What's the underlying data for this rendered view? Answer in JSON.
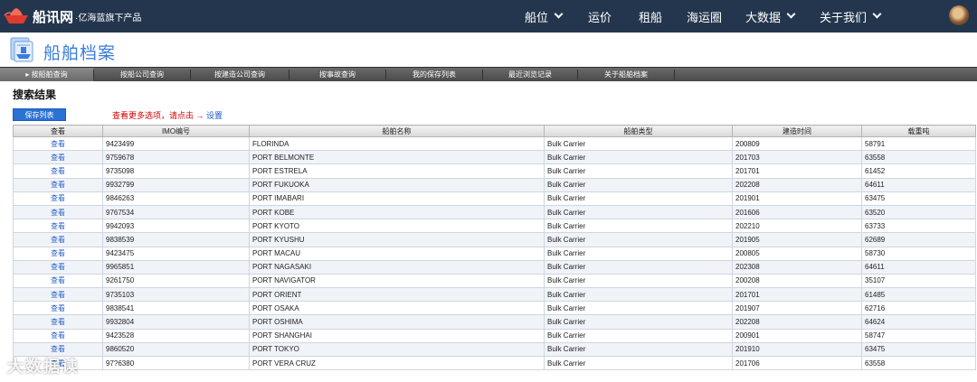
{
  "brand": {
    "name": "船讯网",
    "sub": "·亿海蓝旗下产品"
  },
  "nav": [
    {
      "label": "船位",
      "dropdown": true
    },
    {
      "label": "运价",
      "dropdown": false
    },
    {
      "label": "租船",
      "dropdown": false
    },
    {
      "label": "海运圈",
      "dropdown": false
    },
    {
      "label": "大数据",
      "dropdown": true
    },
    {
      "label": "关于我们",
      "dropdown": true
    }
  ],
  "header": {
    "title": "船舶档案"
  },
  "tabs": [
    {
      "label": "按船舶查询",
      "active": true
    },
    {
      "label": "按船公司查询",
      "active": false
    },
    {
      "label": "按建造公司查询",
      "active": false
    },
    {
      "label": "按事故查询",
      "active": false
    },
    {
      "label": "我的保存列表",
      "active": false
    },
    {
      "label": "最近浏览记录",
      "active": false
    },
    {
      "label": "关于船舶档案",
      "active": false
    }
  ],
  "results": {
    "title": "搜索结果",
    "save_label": "保存列表",
    "hint_text": "查看更多选项，请点击 →",
    "hint_link": "设置",
    "columns": [
      "查看",
      "IMO编号",
      "船舶名称",
      "船舶类型",
      "建造时间",
      "载重吨"
    ],
    "rows": [
      {
        "view": "查看",
        "imo": "9423499",
        "name": "FLORINDA",
        "type": "Bulk Carrier",
        "built": "200809",
        "dwt": "58791"
      },
      {
        "view": "查看",
        "imo": "9759678",
        "name": "PORT BELMONTE",
        "type": "Bulk Carrier",
        "built": "201703",
        "dwt": "63558"
      },
      {
        "view": "查看",
        "imo": "9735098",
        "name": "PORT ESTRELA",
        "type": "Bulk Carrier",
        "built": "201701",
        "dwt": "61452"
      },
      {
        "view": "查看",
        "imo": "9932799",
        "name": "PORT FUKUOKA",
        "type": "Bulk Carrier",
        "built": "202208",
        "dwt": "64611"
      },
      {
        "view": "查看",
        "imo": "9846263",
        "name": "PORT IMABARI",
        "type": "Bulk Carrier",
        "built": "201901",
        "dwt": "63475"
      },
      {
        "view": "查看",
        "imo": "9767534",
        "name": "PORT KOBE",
        "type": "Bulk Carrier",
        "built": "201606",
        "dwt": "63520"
      },
      {
        "view": "查看",
        "imo": "9942093",
        "name": "PORT KYOTO",
        "type": "Bulk Carrier",
        "built": "202210",
        "dwt": "63733"
      },
      {
        "view": "查看",
        "imo": "9838539",
        "name": "PORT KYUSHU",
        "type": "Bulk Carrier",
        "built": "201905",
        "dwt": "62689"
      },
      {
        "view": "查看",
        "imo": "9423475",
        "name": "PORT MACAU",
        "type": "Bulk Carrier",
        "built": "200805",
        "dwt": "58730"
      },
      {
        "view": "查看",
        "imo": "9965851",
        "name": "PORT NAGASAKI",
        "type": "Bulk Carrier",
        "built": "202308",
        "dwt": "64611"
      },
      {
        "view": "查看",
        "imo": "9261750",
        "name": "PORT NAVIGATOR",
        "type": "Bulk Carrier",
        "built": "200208",
        "dwt": "35107"
      },
      {
        "view": "查看",
        "imo": "9735103",
        "name": "PORT ORIENT",
        "type": "Bulk Carrier",
        "built": "201701",
        "dwt": "61485"
      },
      {
        "view": "查看",
        "imo": "9838541",
        "name": "PORT OSAKA",
        "type": "Bulk Carrier",
        "built": "201907",
        "dwt": "62716"
      },
      {
        "view": "查看",
        "imo": "9932804",
        "name": "PORT OSHIMA",
        "type": "Bulk Carrier",
        "built": "202208",
        "dwt": "64624"
      },
      {
        "view": "查看",
        "imo": "9423528",
        "name": "PORT SHANGHAI",
        "type": "Bulk Carrier",
        "built": "200901",
        "dwt": "58747"
      },
      {
        "view": "查看",
        "imo": "9860520",
        "name": "PORT TOKYO",
        "type": "Bulk Carrier",
        "built": "201910",
        "dwt": "63475"
      },
      {
        "view": "查看",
        "imo": "97?6380",
        "name": "PORT VERA CRUZ",
        "type": "Bulk Carrier",
        "built": "201706",
        "dwt": "63558"
      }
    ]
  },
  "watermark": "大数据读",
  "colors": {
    "navbar": "#24364e",
    "accent": "#3b7dd8",
    "link": "#2a62c9",
    "hint": "#d10000"
  }
}
